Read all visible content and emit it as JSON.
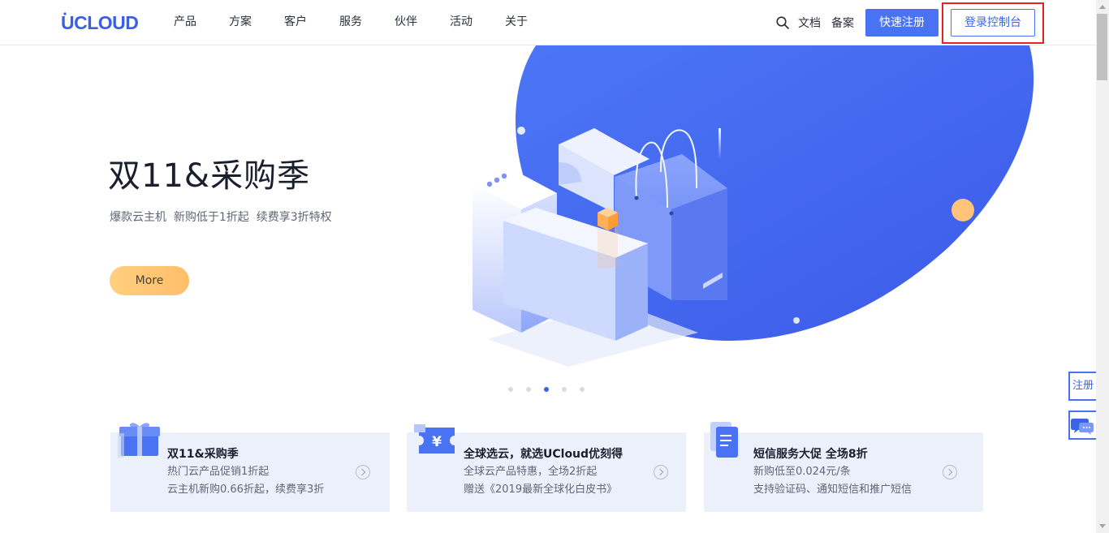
{
  "header": {
    "logo_text": "UCLOUD",
    "nav": [
      "产品",
      "方案",
      "客户",
      "服务",
      "伙伴",
      "活动",
      "关于"
    ],
    "docs_label": "文档",
    "filing_label": "备案",
    "register_label": "快速注册",
    "console_label": "登录控制台"
  },
  "hero": {
    "title": "双11&采购季",
    "subtitle": "爆款云主机  新购低于1折起  续费享3折特权",
    "more_label": "More",
    "slide_count": 5,
    "active_slide": 3
  },
  "cards": [
    {
      "title": "双11&采购季",
      "line1": "热门云产品促销1折起",
      "line2": "云主机新购0.66折起，续费享3折",
      "icon": "gift-icon"
    },
    {
      "title": "全球选云，就选UCloud优刻得",
      "line1": "全球云产品特惠，全场2折起",
      "line2": "赠送《2019最新全球化白皮书》",
      "icon": "yen-ticket-icon"
    },
    {
      "title": "短信服务大促 全场8折",
      "line1": "新购低至0.024元/条",
      "line2": "支持验证码、通知短信和推广短信",
      "icon": "document-icon"
    }
  ],
  "side": {
    "register_label": "注册"
  },
  "colors": {
    "brand": "#4a73f3",
    "hero_blob": "#4a6ff0",
    "more_button": "#ffc472",
    "highlight": "#e8221d"
  }
}
